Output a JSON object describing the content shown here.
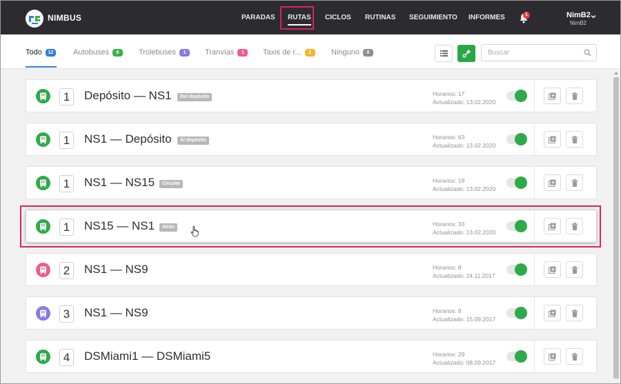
{
  "app": {
    "brand": "NIMBUS"
  },
  "nav": {
    "items": [
      {
        "label": "PARADAS"
      },
      {
        "label": "RUTAS"
      },
      {
        "label": "CICLOS"
      },
      {
        "label": "RUTINAS"
      },
      {
        "label": "SEGUIMIENTO"
      },
      {
        "label": "INFORMES"
      }
    ],
    "active": "RUTAS",
    "notifications": "1"
  },
  "user": {
    "name": "NimB2",
    "sub": "NimB2"
  },
  "tabs": [
    {
      "label": "Todo",
      "count": "12",
      "color": "#2f7de1"
    },
    {
      "label": "Autobuses",
      "count": "9",
      "color": "#3bb14a"
    },
    {
      "label": "Trolebuses",
      "count": "1",
      "color": "#8b78e6"
    },
    {
      "label": "Tranvías",
      "count": "1",
      "color": "#f05a8c"
    },
    {
      "label": "Taxis de r...",
      "count": "1",
      "color": "#f5b52e"
    },
    {
      "label": "Ninguno",
      "count": "0",
      "color": "#8a8f99"
    }
  ],
  "search": {
    "placeholder": "Buscar",
    "value": ""
  },
  "routes": [
    {
      "number": "1",
      "name": "Depósito — NS1",
      "tag": "Del depósito",
      "type_color": "#2eaa4a",
      "schedules": "Horarios: 17",
      "updated": "Actualizado: 13.02.2020",
      "enabled": true
    },
    {
      "number": "1",
      "name": "NS1 — Depósito",
      "tag": "Al depósito",
      "type_color": "#2eaa4a",
      "schedules": "Horarios: 63",
      "updated": "Actualizado: 13.02.2020",
      "enabled": true
    },
    {
      "number": "1",
      "name": "NS1 — NS15",
      "tag": "Circular",
      "type_color": "#2eaa4a",
      "schedules": "Horarios: 19",
      "updated": "Actualizado: 13.02.2020",
      "enabled": true
    },
    {
      "number": "1",
      "name": "NS15 — NS1",
      "tag": "Atrás",
      "type_color": "#2eaa4a",
      "schedules": "Horarios: 33",
      "updated": "Actualizado: 13.02.2020",
      "enabled": true
    },
    {
      "number": "2",
      "name": "NS1 — NS9",
      "tag": "",
      "type_color": "#f05a8c",
      "schedules": "Horarios: 8",
      "updated": "Actualizado: 24.11.2017",
      "enabled": true
    },
    {
      "number": "3",
      "name": "NS1 — NS9",
      "tag": "",
      "type_color": "#8b78e6",
      "schedules": "Horarios: 8",
      "updated": "Actualizado: 15.09.2017",
      "enabled": true
    },
    {
      "number": "4",
      "name": "DSMiami1 — DSMiami5",
      "tag": "",
      "type_color": "#2eaa4a",
      "schedules": "Horarios: 29",
      "updated": "Actualizado: 08.09.2017",
      "enabled": true
    }
  ],
  "icons": {
    "logo": "nimbus-logo-icon",
    "bell": "bell-icon",
    "list": "list-icon",
    "add_route": "add-route-icon",
    "search": "search-icon",
    "bus": "bus-icon",
    "copy": "copy-icon",
    "delete": "trash-icon"
  }
}
